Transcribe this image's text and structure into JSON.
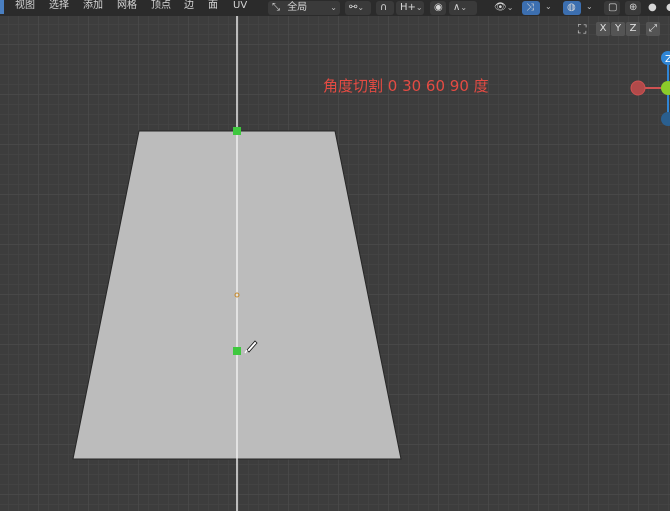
{
  "menu": [
    {
      "label": "视图"
    },
    {
      "label": "选择"
    },
    {
      "label": "添加"
    },
    {
      "label": "网格"
    },
    {
      "label": "顶点"
    },
    {
      "label": "边"
    },
    {
      "label": "面"
    },
    {
      "label": "UV"
    }
  ],
  "toolbar": {
    "transform_orientation": "全局",
    "snap_label": "H+",
    "axis_buttons": [
      "X",
      "Y",
      "Z"
    ]
  },
  "hint_text": "角度切割 0 30 60 90 度",
  "gizmo": {
    "z_label": "Z"
  },
  "colors": {
    "hint": "#e44b43",
    "face": "#bcbcbc",
    "vertex_selected": "#3ec83e",
    "axis_x": "#d05252",
    "axis_y": "#8ccc2a",
    "axis_z": "#2f86d6"
  },
  "icons": [
    "transform-orientation-icon",
    "link-icon",
    "magnet-icon",
    "proportional-icon",
    "falloff-icon",
    "eye-icon",
    "cursor-tool-icon",
    "overlay-icon",
    "wireframe-icon",
    "globe-icon",
    "solid-shading-icon",
    "lock-axis-icon",
    "maximize-icon",
    "knife-cursor-icon"
  ]
}
